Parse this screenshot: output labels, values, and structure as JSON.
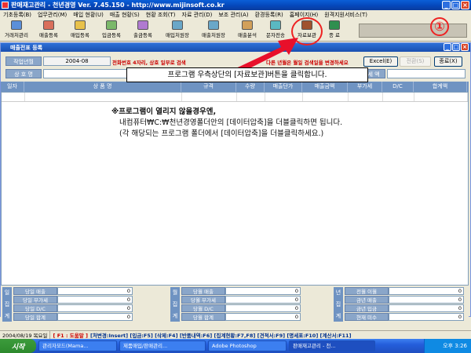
{
  "window": {
    "title": "판매재고관리 - 천년경영 Ver. 7.45.150 - http://www.mijinsoft.co.kr"
  },
  "menu": [
    "기초등록(B)",
    "업무관리(M)",
    "매입 현황(U)",
    "매출 현황(S)",
    "현황 조회(T)",
    "자료 관리(D)",
    "보조 관리(A)",
    "환경등록(R)",
    "홈페이지(H)",
    "원격지원서비스(T)"
  ],
  "toolbar": [
    "거래처관리",
    "매출등록",
    "매입등록",
    "입금등록",
    "출금등록",
    "매입처원장",
    "매출처원장",
    "매출분석",
    "문자전송",
    "자료보관",
    "종 료"
  ],
  "step_marker": "①",
  "document": {
    "title": "매출전표 등록",
    "work_year_label": "작업년월",
    "work_year_value": "2004-08",
    "hint": "전화번호 4자리, 상호 일부로 검색",
    "red_note": "다른 년월은 월일 검색일을 변경하세요",
    "buttons": [
      "Excel(E)",
      "전환(S)",
      "종료(X)"
    ],
    "company_label": "상 호 명",
    "tax_label": "세 액",
    "columns": [
      "일자",
      "상 품 명",
      "규격",
      "수량",
      "매출단가",
      "매출금액",
      "부가세",
      "D/C",
      "합계액"
    ]
  },
  "callout": "프로그램 우측상단의 [자료보관]버튼을 클릭합니다.",
  "notice": [
    "※프로그램이 열리지 않을경우엔,",
    "내컴퓨터₩C:₩천년경영폴더안의 [데이터압축]을 더블클릭하면 됩니다.",
    "(각 해당되는 프로그램 폴더에서 [데이터압축]을 더블클릭하세요.)"
  ],
  "summary": [
    {
      "header": [
        "일",
        "집",
        "계"
      ],
      "rows": [
        {
          "label": "당일 매출",
          "value": "0"
        },
        {
          "label": "당일 부가세",
          "value": "0"
        },
        {
          "label": "당일 D/C",
          "value": "0"
        },
        {
          "label": "당일 합계",
          "value": "0"
        }
      ]
    },
    {
      "header": [
        "월",
        "집",
        "계"
      ],
      "rows": [
        {
          "label": "당월 매출",
          "value": "0"
        },
        {
          "label": "당월 부가세",
          "value": "0"
        },
        {
          "label": "당월 D/C",
          "value": "0"
        },
        {
          "label": "당월 합계",
          "value": "0"
        }
      ]
    },
    {
      "header": [
        "년",
        "집",
        "계"
      ],
      "rows": [
        {
          "label": "전월 이월",
          "value": "0"
        },
        {
          "label": "금년 매출",
          "value": "0"
        },
        {
          "label": "금년 입금",
          "value": "0"
        },
        {
          "label": "현재 미수",
          "value": "0"
        }
      ]
    }
  ],
  "status": {
    "date": "2004/08/19 목요일",
    "help": "[ F1 : 도움말 ]",
    "keys": "[처변경:Insert] [입금:F5] [삭제:F4] [반품내역:F6] [집계현황:F7,F8] [견적서:F9] [명세표:F10] [계산서:F11]"
  },
  "taskbar": {
    "start": "시작",
    "tasks": [
      "관리자모드(Mama...",
      "제품매입/판매관리...",
      "Adobe Photoshop",
      "판매재고관리 - 천..."
    ],
    "clock": "오후 3:26"
  },
  "colors": {
    "titlebar": "#0546b8",
    "label": "#8aa6c9",
    "header": "#6f93c2",
    "marker": "#ee2222"
  }
}
